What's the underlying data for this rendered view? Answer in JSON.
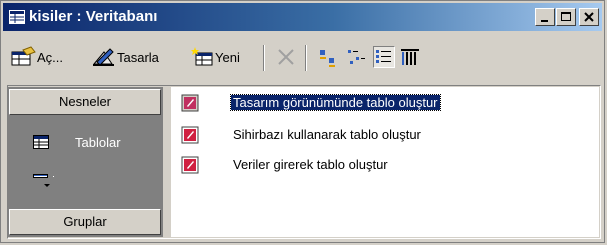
{
  "window": {
    "title": "kisiler : Veritabanı"
  },
  "toolbar": {
    "open_label": "Aç...",
    "design_label": "Tasarla",
    "new_label": "Yeni"
  },
  "objects_pane": {
    "header": "Nesneler",
    "items": [
      {
        "label": "Tablolar",
        "icon": "table-icon",
        "selected": true
      },
      {
        "label": "",
        "icon": "query-icon",
        "selected": false
      }
    ],
    "groups_label": "Gruplar"
  },
  "list": {
    "items": [
      {
        "label": "Tasarım görünümünde tablo oluştur",
        "icon": "create-table-design-icon",
        "selected": true
      },
      {
        "label": "Sihirbazı kullanarak tablo oluştur",
        "icon": "create-table-wizard-icon",
        "selected": false
      },
      {
        "label": "Veriler girerek tablo oluştur",
        "icon": "create-table-data-icon",
        "selected": false
      }
    ]
  },
  "colors": {
    "titlebar_start": "#0a246a",
    "titlebar_end": "#a6caf0",
    "selection": "#0a246a",
    "pane_bg": "#808080"
  }
}
